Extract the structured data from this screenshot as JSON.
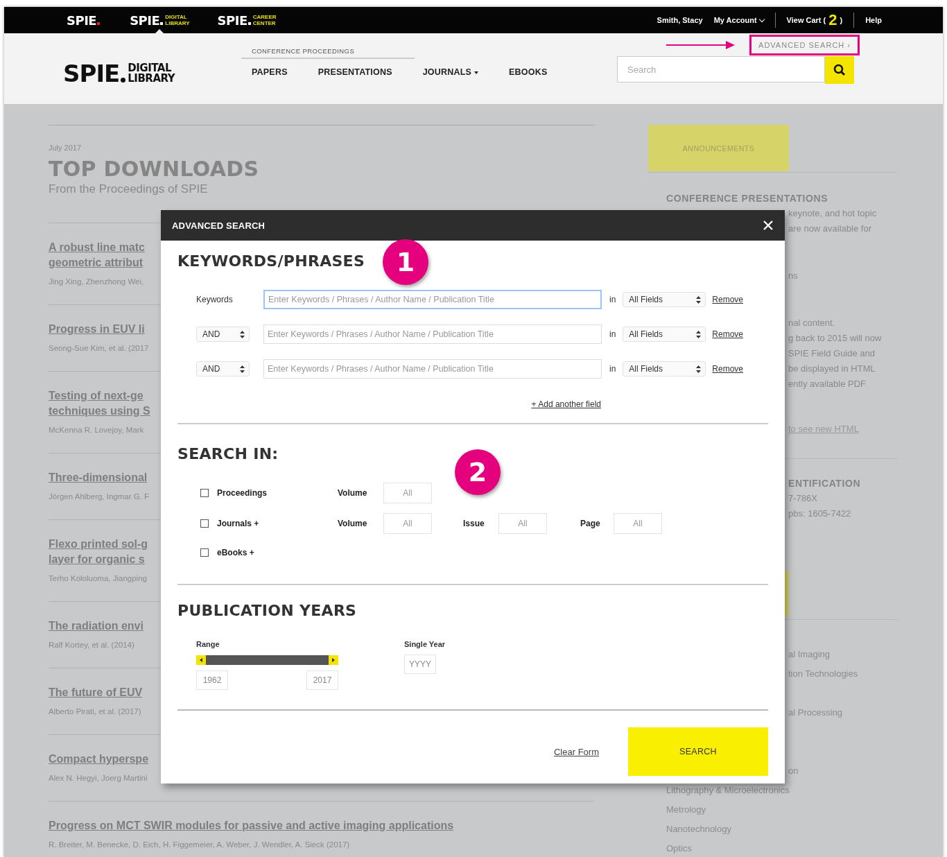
{
  "topbar": {
    "sites": [
      {
        "name": "SPIE",
        "color": "#e3262b",
        "selected": false
      },
      {
        "name": "SPIE",
        "color": "#ffffff",
        "tagline": [
          "DIGITAL",
          "LIBRARY"
        ],
        "selected": true
      },
      {
        "name": "SPIE",
        "color": "#ffffff",
        "tagline": [
          "CAREER",
          "CENTER"
        ],
        "selected": false
      }
    ],
    "user": "Smith, Stacy",
    "account": "My Account",
    "cart": {
      "label": "View Cart (",
      "count": "2",
      "close": ")"
    },
    "help": "Help"
  },
  "header": {
    "logo": {
      "name": "SPIE",
      "tagline": [
        "DIGITAL",
        "LIBRARY"
      ]
    },
    "nav": {
      "group_label": "CONFERENCE PROCEEDINGS",
      "items": [
        {
          "label": "PAPERS",
          "dropdown": false
        },
        {
          "label": "PRESENTATIONS",
          "dropdown": false
        },
        {
          "label": "JOURNALS",
          "dropdown": true
        },
        {
          "label": "EBOOKS",
          "dropdown": false
        }
      ]
    },
    "search": {
      "placeholder": "Search"
    },
    "advanced_search": {
      "label": "ADVANCED SEARCH",
      "chevron": "›",
      "highlighted": true
    }
  },
  "main": {
    "date": "July 2017",
    "title": "TOP DOWNLOADS",
    "subtitle": "From the Proceedings of SPIE",
    "articles": [
      {
        "title": [
          "A robust line matc",
          "geometric attribut"
        ],
        "authors": "Jing Xing, Zhenzhong Wei,"
      },
      {
        "title": [
          "Progress in EUV li"
        ],
        "authors": "Seong-Sue Kim, et al. (2017"
      },
      {
        "title": [
          "Testing of next-ge",
          "techniques using S"
        ],
        "authors": "McKenna R. Lovejoy, Mark"
      },
      {
        "title": [
          "Three-dimensional"
        ],
        "authors": "Jörgen Ahlberg, Ingmar G. F"
      },
      {
        "title": [
          "Flexo printed sol-g",
          "layer for organic s"
        ],
        "authors": "Terho Kololuoma, Jiangping"
      },
      {
        "title": [
          "The radiation envi"
        ],
        "authors": "Ralf Kortey, et al. (2014)"
      },
      {
        "title": [
          "The future of EUV"
        ],
        "authors": "Alberto Pirati, et al. (2017)"
      },
      {
        "title": [
          "Compact hyperspe"
        ],
        "authors": "Alex N. Hegyi, Joerg Martini"
      },
      {
        "title": [
          "Progress on MCT SWIR modules for passive and active imaging applications"
        ],
        "authors": "R. Breiter, M. Benecke, D. Eich, H. Figgemeier, A. Weber, J. Wendler, A. Sieck (2017)"
      }
    ]
  },
  "sidebar": {
    "announcements": "ANNOUNCEMENTS",
    "heading": "CONFERENCE PRESENTATIONS",
    "paragraphs": [
      [
        "keynote, and hot topic",
        "are now available for"
      ],
      [
        "ns"
      ],
      [
        "nal content.",
        "g back to 2015 will now",
        "SPIE Field Guide and",
        "be displayed in HTML",
        "ently available PDF"
      ]
    ],
    "link": "to see new HTML",
    "id_heading": "ENTIFICATION",
    "id_lines": [
      "7-786X",
      "pbs: 1605-7422"
    ],
    "topic_groups": [
      [
        "al Imaging",
        "tion Technologies"
      ],
      [
        "al Processing"
      ],
      [
        "on"
      ]
    ],
    "topics": [
      "Lithography & Microelectronics",
      "Metrology",
      "Nanotechnology",
      "Optics"
    ]
  },
  "modal": {
    "title": "ADVANCED SEARCH",
    "keywords": {
      "heading": "KEYWORDS/PHRASES",
      "rows": [
        {
          "kind": "label",
          "label": "Keywords",
          "placeholder": "Enter Keywords / Phrases / Author Name / Publication Title",
          "focused": true,
          "in": "in",
          "field": "All Fields",
          "remove": "Remove"
        },
        {
          "kind": "operator",
          "label": "AND",
          "placeholder": "Enter Keywords / Phrases / Author Name / Publication Title",
          "focused": false,
          "in": "in",
          "field": "All Fields",
          "remove": "Remove"
        },
        {
          "kind": "operator",
          "label": "AND",
          "placeholder": "Enter Keywords / Phrases / Author Name / Publication Title",
          "focused": false,
          "in": "in",
          "field": "All Fields",
          "remove": "Remove"
        }
      ],
      "add": "+ Add another field"
    },
    "search_in": {
      "heading": "SEARCH IN:",
      "rows": [
        {
          "label": "Proceedings",
          "checked": false,
          "fields": [
            {
              "label": "Volume",
              "placeholder": "All"
            }
          ]
        },
        {
          "label": "Journals +",
          "checked": false,
          "fields": [
            {
              "label": "Volume",
              "placeholder": "All"
            },
            {
              "label": "Issue",
              "placeholder": "All"
            },
            {
              "label": "Page",
              "placeholder": "All"
            }
          ]
        },
        {
          "label": "eBooks +",
          "checked": false
        }
      ]
    },
    "years": {
      "heading": "PUBLICATION YEARS",
      "range": {
        "label": "Range",
        "level": 1,
        "from": "1962",
        "to": "2017"
      },
      "single": {
        "label": "Single Year",
        "placeholder": "YYYY"
      }
    },
    "footer": {
      "clear": "Clear Form",
      "submit": "SEARCH"
    }
  },
  "annotations": {
    "badges": [
      "1",
      "2"
    ]
  }
}
